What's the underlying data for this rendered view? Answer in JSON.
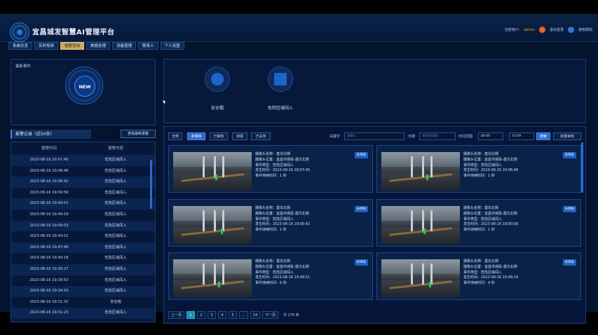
{
  "app": {
    "title": "宜昌城发智慧AI管理平台",
    "user_label": "当前用户:",
    "user_name": "admin",
    "logout_label": "退出登录",
    "help_label": "使用帮助"
  },
  "nav_tabs": [
    {
      "label": "系统总览",
      "active": false
    },
    {
      "label": "实时视频",
      "active": false
    },
    {
      "label": "报警查询",
      "active": true
    },
    {
      "label": "数据处理",
      "active": false
    },
    {
      "label": "设备管理",
      "active": false
    },
    {
      "label": "联系人",
      "active": false
    },
    {
      "label": "个人设置",
      "active": false
    }
  ],
  "events_panel": {
    "title": "最新事件",
    "badge": "NEW"
  },
  "alarm_types": [
    {
      "label": "安全帽",
      "icon": "helmet-icon"
    },
    {
      "label": "危险区域闯入",
      "icon": "restricted-zone-icon"
    }
  ],
  "records": {
    "title": "报警记录（近50条）",
    "view_button": "查看最新报警",
    "columns": [
      "报警时间",
      "报警内容"
    ],
    "rows": [
      [
        "2023-08-16 20:07:45",
        "危险区域闯入"
      ],
      [
        "2023-08-16 20:06:46",
        "危险区域闯入"
      ],
      [
        "2023-08-16 19:56:42",
        "危险区域闯入"
      ],
      [
        "2023-08-16 19:50:56",
        "危险区域闯入"
      ],
      [
        "2023-08-16 19:49:51",
        "危险区域闯入"
      ],
      [
        "2023-08-16 19:49:19",
        "危险区域闯入"
      ],
      [
        "2023-08-16 19:49:03",
        "危险区域闯入"
      ],
      [
        "2023-08-16 19:43:51",
        "危险区域闯入"
      ],
      [
        "2023-08-16 19:47:46",
        "危险区域闯入"
      ],
      [
        "2023-08-16 19:40:18",
        "危险区域闯入"
      ],
      [
        "2023-08-16 19:39:27",
        "危险区域闯入"
      ],
      [
        "2023-08-16 19:38:50",
        "危险区域闯入"
      ],
      [
        "2023-08-16 19:34:50",
        "危险区域闯入"
      ],
      [
        "2023-08-16 19:31:32",
        "安全帽"
      ],
      [
        "2023-08-16 19:31:23",
        "危险区域闯入"
      ]
    ]
  },
  "filters": {
    "buttons": [
      {
        "label": "全部",
        "active": false
      },
      {
        "label": "未审核",
        "active": true
      },
      {
        "label": "已审核",
        "active": false
      },
      {
        "label": "误报",
        "active": false
      },
      {
        "label": "已关单",
        "active": false
      }
    ],
    "keyword_label": "关键字",
    "keyword_placeholder": "请输入",
    "date_label": "日期",
    "date_placeholder": "请选择日期",
    "time_label": "时间范围",
    "time_start": "00:00",
    "time_sep": "-",
    "time_end": "23:59",
    "search_button": "搜索",
    "batch_button": "批量审核"
  },
  "alarm_cards": [
    {
      "camera": "摄像头名称：基坑北侧",
      "location": "摄像头位置：宜昌市城投-基坑北侧",
      "type": "事件类型：危险区域闯入",
      "time": "发生时间：2023-08-16 20:07:45",
      "duration": "事件持续时间：1 秒",
      "status": "未审核"
    },
    {
      "camera": "摄像头名称：基坑北侧",
      "location": "摄像头位置：宜昌市城投-基坑北侧",
      "type": "事件类型：危险区域闯入",
      "time": "发生时间：2023-08-16 20:06:46",
      "duration": "事件持续时间：1 秒",
      "status": "未审核"
    },
    {
      "camera": "摄像头名称：基坑北侧",
      "location": "摄像头位置：宜昌市城投-基坑北侧",
      "type": "事件类型：危险区域闯入",
      "time": "发生时间：2023-08-16 19:56:42",
      "duration": "事件持续时间：1 秒",
      "status": "未审核"
    },
    {
      "camera": "摄像头名称：基坑北侧",
      "location": "摄像头位置：宜昌市城投-基坑北侧",
      "type": "事件类型：危险区域闯入",
      "time": "发生时间：2023-08-16 19:50:56",
      "duration": "事件持续时间：1 秒",
      "status": "未审核"
    },
    {
      "camera": "摄像头名称：基坑北侧",
      "location": "摄像头位置：宜昌市城投-基坑北侧",
      "type": "事件类型：危险区域闯入",
      "time": "发生时间：2023-08-16 19:49:51",
      "duration": "事件持续时间：6 秒",
      "status": "未审核"
    },
    {
      "camera": "摄像头名称：基坑北侧",
      "location": "摄像头位置：宜昌市城投-基坑北侧",
      "type": "事件类型：危险区域闯入",
      "time": "发生时间：2023-08-16 19:49:19",
      "duration": "事件持续时间：4 秒",
      "status": "未审核"
    }
  ],
  "pagination": {
    "prev": "上一页",
    "pages": [
      "1",
      "2",
      "3",
      "4",
      "5",
      "...",
      "14"
    ],
    "active_page": "1",
    "next": "下一页",
    "total": "共 278 条"
  },
  "colors": {
    "accent": "#2a6bd0",
    "active_tab": "#c8a76a",
    "background": "#04132e"
  }
}
